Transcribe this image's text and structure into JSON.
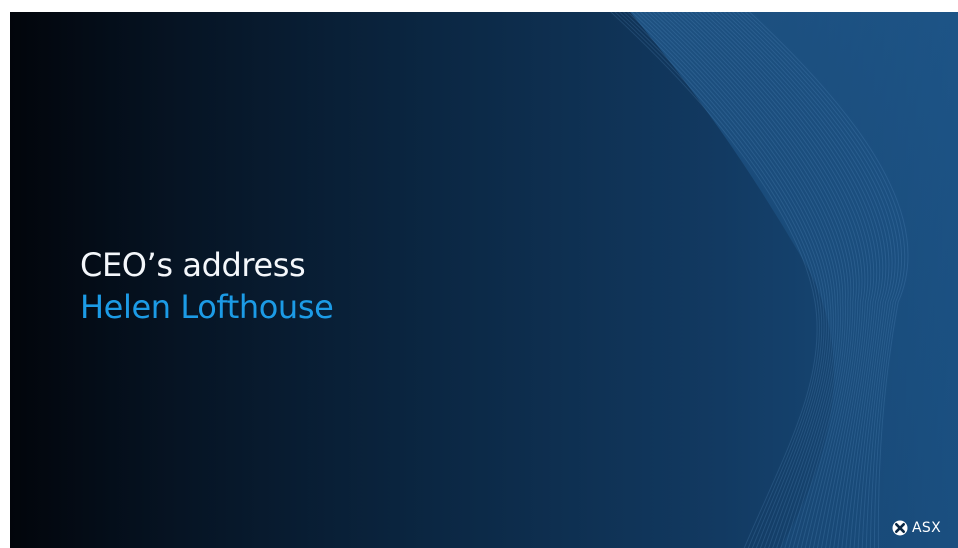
{
  "slide": {
    "title": "CEO’s address",
    "subtitle": "Helen Lofthouse",
    "brand": "ASX"
  },
  "colors": {
    "background_dark": "#02050b",
    "background_light": "#1a4f80",
    "title_text": "#f4f7fb",
    "subtitle_accent": "#1c9be6",
    "brand_text": "#ffffff"
  },
  "icons": {
    "logo": "asx-logo-icon"
  }
}
